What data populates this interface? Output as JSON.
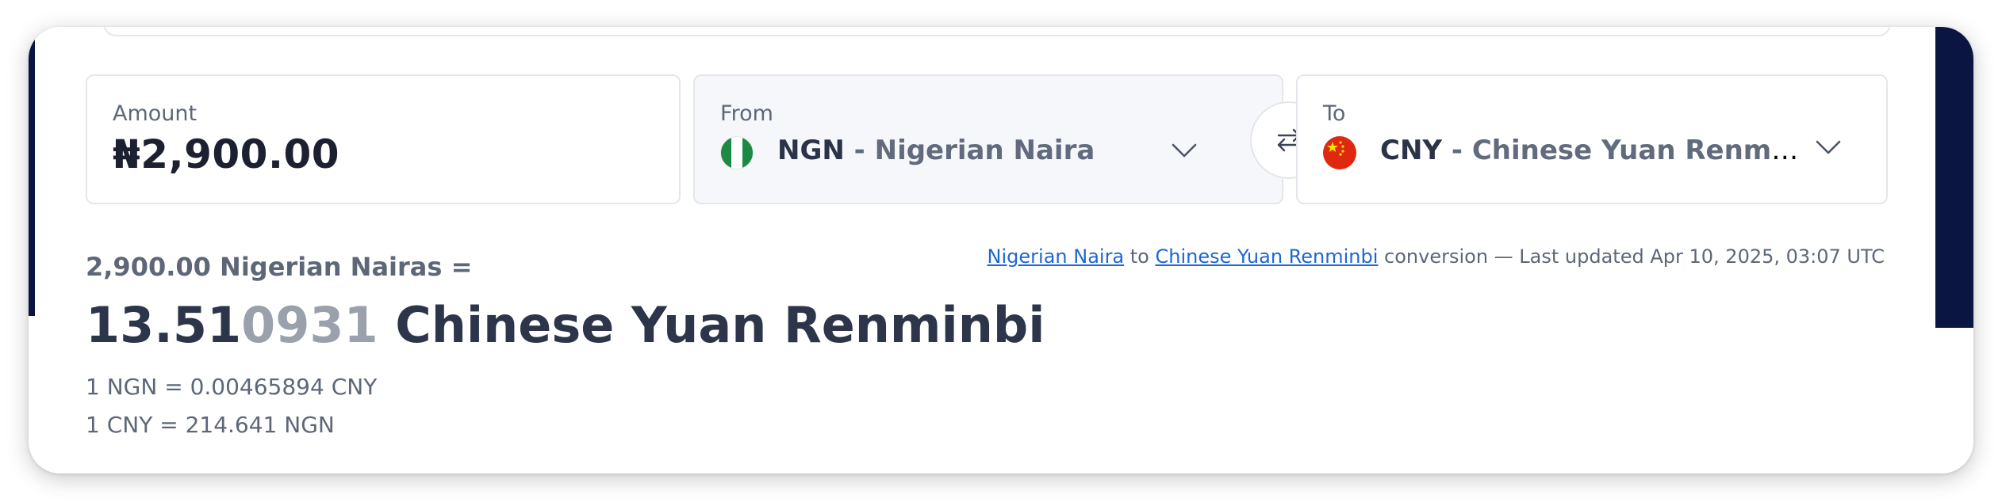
{
  "converter": {
    "amount": {
      "label": "Amount",
      "value": "₦2,900.00"
    },
    "from": {
      "label": "From",
      "code": "NGN",
      "name": " - Nigerian Naira",
      "flag_icon": "nigeria-flag-icon"
    },
    "to": {
      "label": "To",
      "code": "CNY",
      "name": " - Chinese Yuan Renminbi",
      "flag_icon": "china-flag-icon"
    },
    "swap_icon": "swap-arrows-icon"
  },
  "result": {
    "from_text": "2,900.00 Nigerian Nairas =",
    "value_main": "13.51",
    "value_dim": "0931",
    "currency": " Chinese Yuan Renminbi",
    "rate_forward": "1 NGN = 0.00465894 CNY",
    "rate_reverse": "1 CNY = 214.641 NGN"
  },
  "update": {
    "link1": "Nigerian Naira",
    "between": " to ",
    "link2": "Chinese Yuan Renminbi",
    "suffix": " conversion — Last updated Apr 10, 2025, 03:07 UTC"
  },
  "colors": {
    "navy": "#0b1541",
    "link": "#1f66d1",
    "text_dark": "#2c3549",
    "text_muted": "#5d6778"
  }
}
